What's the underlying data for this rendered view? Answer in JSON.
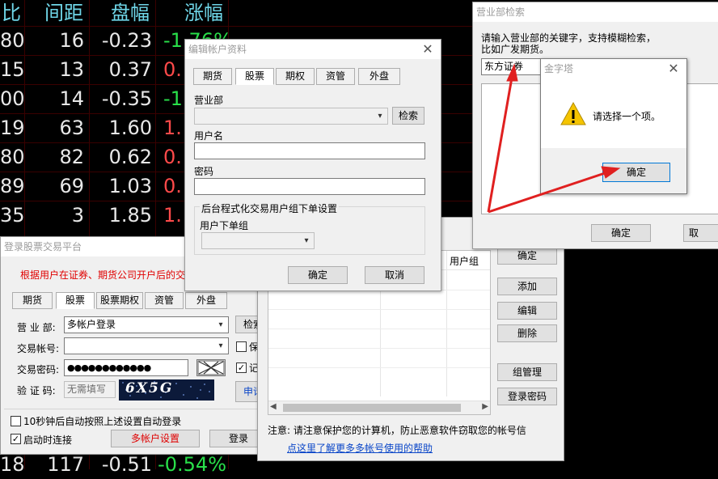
{
  "stock": {
    "headers": [
      "比",
      "间距",
      "盘幅",
      "涨幅"
    ],
    "rows": [
      [
        "80",
        "16",
        "-0.23",
        "-1.76%"
      ],
      [
        "15",
        "13",
        "0.37",
        "0."
      ],
      [
        "00",
        "14",
        "-0.35",
        "-1."
      ],
      [
        "19",
        "63",
        "1.60",
        "1."
      ],
      [
        "80",
        "82",
        "0.62",
        "0."
      ],
      [
        "89",
        "69",
        "1.03",
        "0."
      ],
      [
        "35",
        "3",
        "1.85",
        "1."
      ]
    ],
    "last_row": [
      "18",
      "117",
      "-0.51",
      "-0.54%"
    ]
  },
  "login_window": {
    "title": "登录股票交易平台",
    "notice": "根据用户在证券、期货公司开户后的交",
    "tabs": [
      "期货",
      "股票",
      "股票期权",
      "资管",
      "外盘"
    ],
    "branch_label": "营 业 部:",
    "branch_value": "多帐户登录",
    "search_btn": "检索",
    "account_label": "交易帐号:",
    "password_label": "交易密码:",
    "password_value": "●●●●●●●●●●●●",
    "captcha_label": "验 证 码:",
    "captcha_placeholder": "无需填写",
    "captcha_text": "6X5G",
    "side_check1": "保",
    "side_check2": "记",
    "apply_btn": "申请",
    "auto_login": "10秒钟后自动按照上述设置自动登录",
    "auto_connect": "启动时连接",
    "multi_account_btn": "多帐户设置",
    "login_btn": "登录"
  },
  "multi_window": {
    "col_header": "用户组",
    "buttons": [
      "确定",
      "添加",
      "编辑",
      "删除",
      "组管理",
      "登录密码"
    ],
    "notice": "注意: 请注意保护您的计算机，防止恶意软件窃取您的帐号信",
    "help_link": "点这里了解更多多帐号使用的帮助"
  },
  "edit_window": {
    "title": "编辑帐户资料",
    "tabs": [
      "期货",
      "股票",
      "期权",
      "资管",
      "外盘"
    ],
    "branch_label": "营业部",
    "search_btn": "检索",
    "user_label": "用户名",
    "password_label": "密码",
    "group_title": "后台程式化交易用户组下单设置",
    "group_sub_label": "用户下单组",
    "ok_btn": "确定",
    "cancel_btn": "取消"
  },
  "search_window": {
    "title": "营业部检索",
    "hint_line1": "请输入营业部的关键字，支持模糊检索，",
    "hint_line2": "比如广发期货。",
    "input_value": "东方证券",
    "ok_btn": "确定",
    "cancel_btn": "取"
  },
  "alert_window": {
    "title": "金字塔",
    "message": "请选择一个项。",
    "ok_btn": "确定"
  },
  "colors": {
    "annotation_arrow": "#e02020",
    "cyan_header": "#6fd6e8",
    "up_red": "#ff4a4a",
    "down_green": "#29e04a"
  }
}
